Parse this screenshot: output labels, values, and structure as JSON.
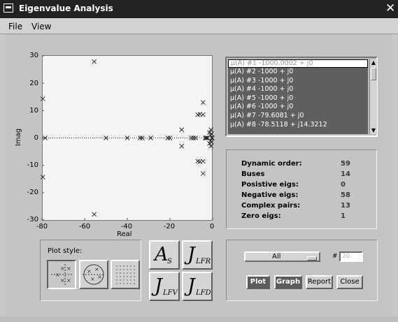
{
  "window": {
    "title": "Eigenvalue Analysis",
    "close_glyph": "✕"
  },
  "menu": [
    {
      "label": "File"
    },
    {
      "label": "View"
    }
  ],
  "plot": {
    "xlabel": "Real",
    "ylabel": "Imag",
    "yticks": [
      "30",
      "20",
      "10",
      "0",
      "-10",
      "-20",
      "-30"
    ],
    "xticks": [
      "-80",
      "-60",
      "-40",
      "-20",
      "0"
    ]
  },
  "chart_data": {
    "type": "scatter",
    "xlabel": "Real",
    "ylabel": "Imag",
    "xlim": [
      -80,
      0
    ],
    "ylim": [
      -30,
      30
    ],
    "grid": false,
    "marker": "x",
    "baseline_dotted_at_y": 0,
    "points": [
      [
        -79.6,
        14.3
      ],
      [
        -79.6,
        -14.3
      ],
      [
        -78.5,
        0
      ],
      [
        -55.5,
        27.9
      ],
      [
        -55.5,
        -27.9
      ],
      [
        -50,
        0
      ],
      [
        -40,
        0
      ],
      [
        -34,
        0
      ],
      [
        -33,
        0
      ],
      [
        -29,
        0
      ],
      [
        -21,
        0
      ],
      [
        -20,
        0
      ],
      [
        -14.5,
        3
      ],
      [
        -14.5,
        -3
      ],
      [
        -10,
        0
      ],
      [
        -9,
        0
      ],
      [
        -8,
        0
      ],
      [
        -7,
        8.5
      ],
      [
        -7,
        -8.5
      ],
      [
        -6,
        8.7
      ],
      [
        -6,
        -8.7
      ],
      [
        -4.5,
        13
      ],
      [
        -4.5,
        -13
      ],
      [
        -4.5,
        8.5
      ],
      [
        -4.5,
        -8.5
      ],
      [
        -3.5,
        0
      ],
      [
        -3,
        0
      ],
      [
        -2.5,
        0
      ],
      [
        -1.5,
        2
      ],
      [
        -1.5,
        -2
      ],
      [
        -1,
        1
      ],
      [
        -1,
        -1
      ],
      [
        -0.8,
        3
      ],
      [
        -0.8,
        -3
      ],
      [
        -0.5,
        1.5
      ],
      [
        -0.5,
        -1.5
      ],
      [
        -0.3,
        0
      ],
      [
        -0.2,
        0
      ]
    ]
  },
  "eig_list": [
    "μ(A) #1  -1000.0002 + j0",
    "μ(A) #2  -1000 + j0",
    "μ(A) #3  -1000 + j0",
    "μ(A) #4  -1000 + j0",
    "μ(A) #5  -1000 + j0",
    "μ(A) #6  -1000 + j0",
    "μ(A) #7  -79.6081 + j0",
    "μ(A) #8  -78.5118 + j14.3212"
  ],
  "stats": [
    {
      "label": "Dynamic order:",
      "value": "59"
    },
    {
      "label": "Buses",
      "value": "14"
    },
    {
      "label": "Posistive eigs:",
      "value": "0"
    },
    {
      "label": "Negative eigs:",
      "value": "58"
    },
    {
      "label": "Complex pairs:",
      "value": "13"
    },
    {
      "label": "Zero eigs:",
      "value": "1"
    }
  ],
  "plot_style": {
    "label": "Plot style:",
    "active_index": 0
  },
  "matrix_buttons": [
    {
      "main": "A",
      "sub": "S"
    },
    {
      "main": "J",
      "sub": "LFR"
    },
    {
      "main": "J",
      "sub": "LFV"
    },
    {
      "main": "J",
      "sub": "LFD"
    }
  ],
  "controls": {
    "dropdown_value": "All",
    "num_label": "#",
    "num_value": "20",
    "buttons": {
      "plot": "Plot",
      "graph": "Graph",
      "report": "Report",
      "close": "Close"
    }
  },
  "colors": {
    "list_bg": "#5f5f5f",
    "title_bg": "#222222",
    "panel_bg": "#c4c4c4",
    "plot_bg": "#f4f4f4"
  }
}
